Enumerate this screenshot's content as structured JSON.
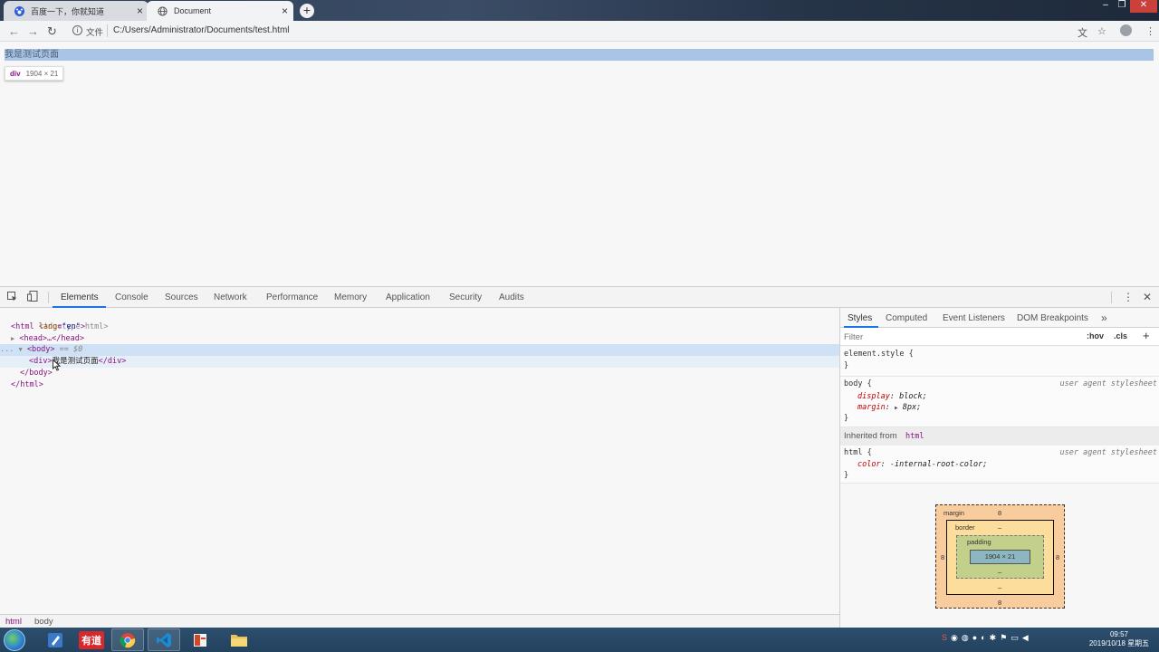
{
  "browser": {
    "tabs": [
      {
        "title": "百度一下，你就知道",
        "active": false,
        "favicon": "baidu-paw-icon"
      },
      {
        "title": "Document",
        "active": true,
        "favicon": "globe-icon"
      }
    ],
    "new_tab_label": "+",
    "url_scheme_label": "文件",
    "url": "C:/Users/Administrator/Documents/test.html"
  },
  "page": {
    "div_text": "我是测试页面",
    "tooltip": {
      "tag": "div",
      "size": "1904 × 21"
    }
  },
  "devtools": {
    "tabs": [
      "Elements",
      "Console",
      "Sources",
      "Network",
      "Performance",
      "Memory",
      "Application",
      "Security",
      "Audits"
    ],
    "active_tab": "Elements",
    "dom": {
      "doctype": "<!doctype html>",
      "html_open_tag": "<html",
      "html_attr_name": "lang",
      "html_attr_value": "\"en\"",
      "html_open_end": ">",
      "head": "<head>…</head>",
      "body_open": "<body>",
      "body_selected_marker": "== $0",
      "div_open": "<div>",
      "div_text": "我是测试页面",
      "div_close": "</div>",
      "body_close": "</body>",
      "html_close": "</html>",
      "ellipsis": "..."
    },
    "breadcrumbs": [
      "html",
      "body"
    ],
    "styles_tabs": [
      "Styles",
      "Computed",
      "Event Listeners",
      "DOM Breakpoints"
    ],
    "filter_placeholder": "Filter",
    "hov_label": ":hov",
    "cls_label": ".cls",
    "rules": {
      "element_style": "element.style {",
      "element_style_close": "}",
      "body_selector": "body {",
      "body_source": "user agent stylesheet",
      "body_props": [
        {
          "name": "display",
          "value": "block;"
        },
        {
          "name": "margin",
          "value": "8px;"
        }
      ],
      "close": "}",
      "inherited_label": "Inherited from",
      "inherited_tag": "html",
      "html_selector": "html {",
      "html_source": "user agent stylesheet",
      "html_props": [
        {
          "name": "color",
          "value": "-internal-root-color;"
        }
      ]
    },
    "box_model": {
      "margin_label": "margin",
      "margin_top": "8",
      "margin_bottom": "8",
      "margin_left": "8",
      "margin_right": "8",
      "border_label": "border",
      "border_value": "–",
      "padding_label": "padding",
      "padding_value": "–",
      "content": "1904 × 21"
    }
  },
  "taskbar": {
    "youdao_label": "有道",
    "clock_time": "09:57",
    "clock_date": "2019/10/18 星期五"
  }
}
